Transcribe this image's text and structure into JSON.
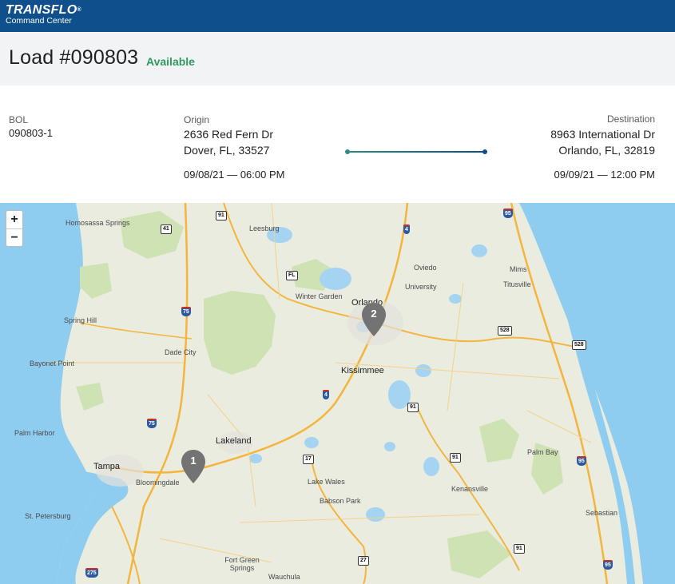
{
  "app": {
    "brand_name": "TRANSFLO",
    "brand_mark": "®",
    "brand_sub": "Command Center",
    "brand_color": "#0e4f8c"
  },
  "load": {
    "title": "Load #090803",
    "status": "Available",
    "status_color": "#2e9b5e"
  },
  "bol": {
    "label": "BOL",
    "value": "090803-1"
  },
  "origin": {
    "label": "Origin",
    "address_line1": "2636 Red Fern Dr",
    "address_line2": "Dover, FL, 33527",
    "datetime": "09/08/21 — 06:00 PM"
  },
  "destination": {
    "label": "Destination",
    "address_line1": "8963 International Dr",
    "address_line2": "Orlando, FL, 32819",
    "datetime": "09/09/21 — 12:00 PM"
  },
  "map": {
    "zoom_in": "+",
    "zoom_out": "−",
    "pins": [
      {
        "label": "1"
      },
      {
        "label": "2"
      }
    ],
    "places": {
      "homosassa": "Homosassa Springs",
      "leesburg": "Leesburg",
      "oviedo": "Oviedo",
      "mims": "Mims",
      "titusville": "Titusville",
      "university": "University",
      "winter_garden": "Winter Garden",
      "orlando": "Orlando",
      "spring_hill": "Spring Hill",
      "dade_city": "Dade City",
      "bayonet_point": "Bayonet Point",
      "kissimmee": "Kissimmee",
      "palm_harbor": "Palm Harbor",
      "lakeland": "Lakeland",
      "tampa": "Tampa",
      "bloomingdale": "Bloomingdale",
      "palm_bay": "Palm Bay",
      "lake_wales": "Lake Wales",
      "kenansville": "Kenansville",
      "babson_park": "Babson Park",
      "st_petersburg": "St. Petersburg",
      "sebastian": "Sebastian",
      "fort_green": "Fort Green Springs",
      "wauchula": "Wauchula"
    },
    "shields": {
      "i95_top": "95",
      "us41": "41",
      "fl91_top": "91",
      "i4_top": "4",
      "fl_state1": "FL",
      "i75_a": "75",
      "fl528_a": "528",
      "fl528_b": "528",
      "i4_mid": "4",
      "fl91_mid": "91",
      "i75_b": "75",
      "us17": "17",
      "fl91_low": "91",
      "i95_mid": "95",
      "fl91_bot": "91",
      "us27": "27",
      "i275": "275",
      "i95_bot": "95"
    }
  }
}
